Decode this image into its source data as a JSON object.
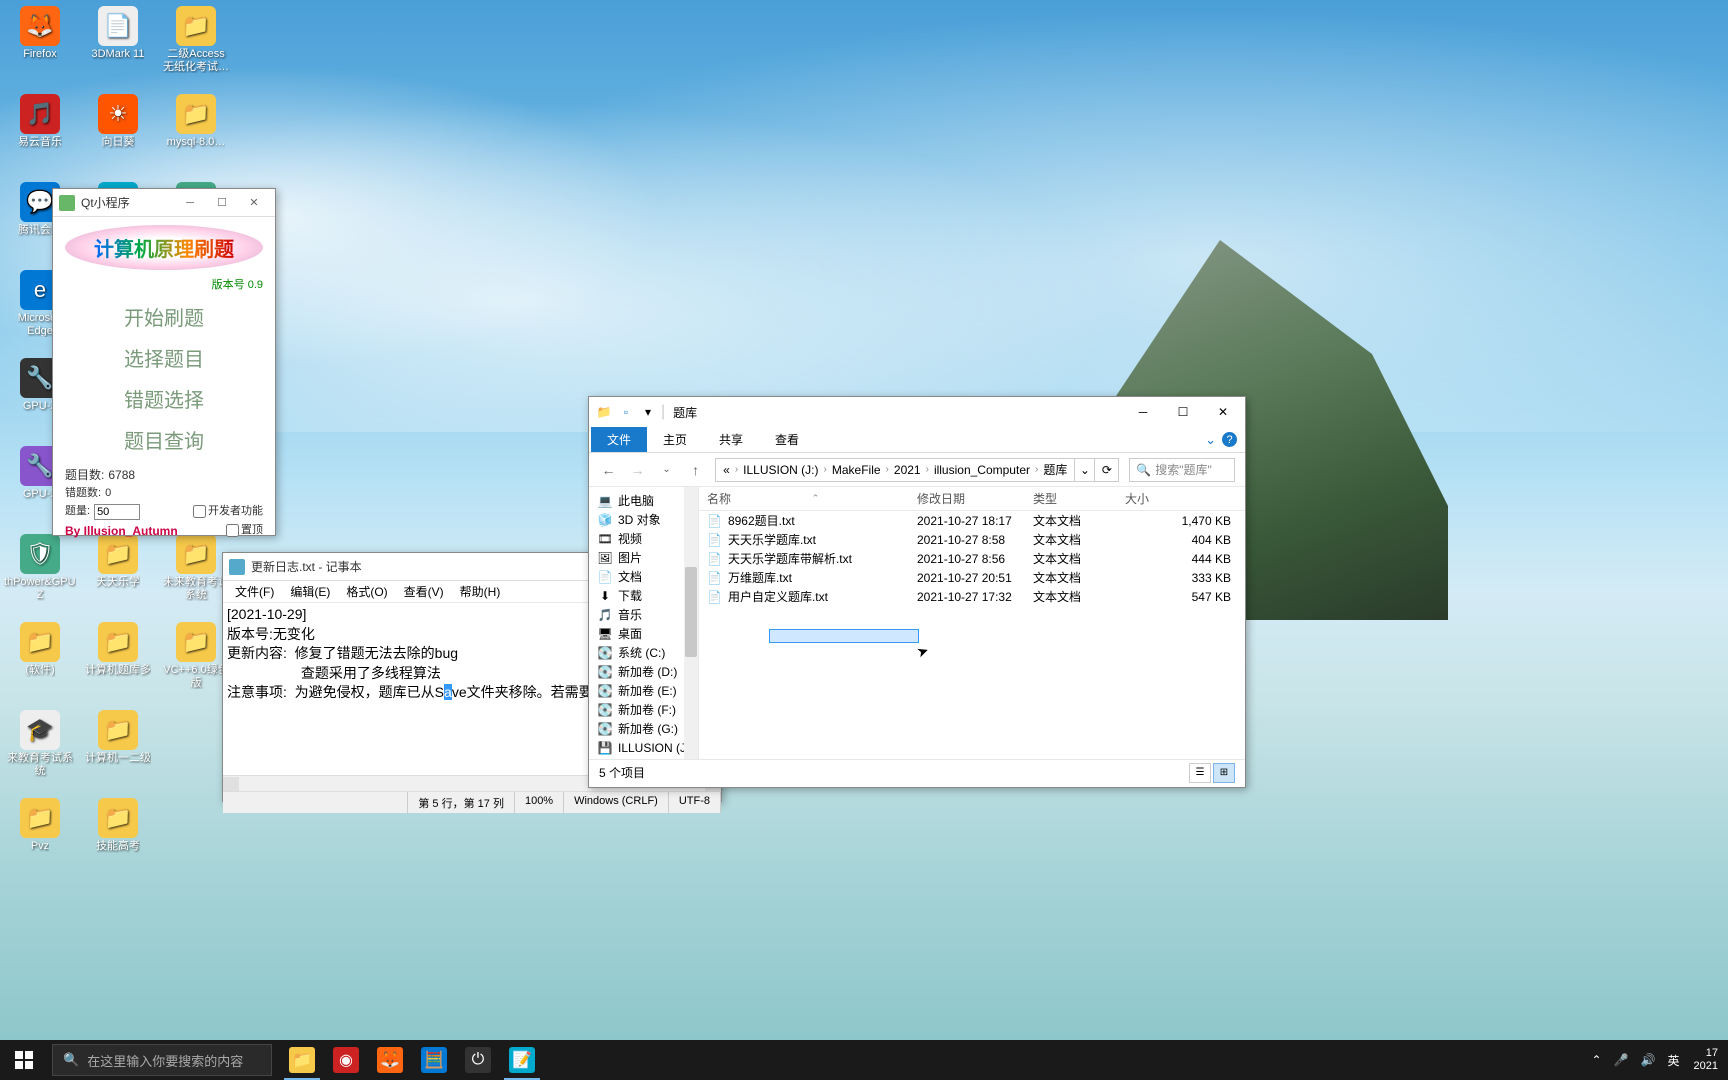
{
  "desktop_icons": [
    [
      {
        "label": "Firefox",
        "color": "c-ff",
        "glyph": "🦊"
      },
      {
        "label": "3DMark 11",
        "color": "c-wt",
        "glyph": "📄"
      },
      {
        "label": "二级Access无纸化考试…",
        "color": "c-yl",
        "glyph": "📁"
      }
    ],
    [
      {
        "label": "易云音乐",
        "color": "c-rd",
        "glyph": "🎵"
      },
      {
        "label": "向日葵",
        "color": "c-or",
        "glyph": "☀"
      },
      {
        "label": "mysql-8.0…",
        "color": "c-yl",
        "glyph": "📁"
      }
    ],
    [
      {
        "label": "腾讯会议",
        "color": "c-bl",
        "glyph": "💬"
      },
      {
        "label": "",
        "color": "c-cy",
        "glyph": "▶"
      },
      {
        "label": "",
        "color": "c-gr",
        "glyph": "🌀"
      }
    ],
    [
      {
        "label": "Microsoft Edge",
        "color": "c-bl",
        "glyph": "e"
      },
      {
        "label": "",
        "color": "",
        "glyph": ""
      },
      {
        "label": "",
        "color": "",
        "glyph": ""
      }
    ],
    [
      {
        "label": "GPU-Z",
        "color": "c-dk",
        "glyph": "🔧"
      },
      {
        "label": "",
        "color": "",
        "glyph": ""
      },
      {
        "label": "",
        "color": "",
        "glyph": ""
      }
    ],
    [
      {
        "label": "GPU-Z",
        "color": "c-pu",
        "glyph": "🔧"
      },
      {
        "label": "",
        "color": "",
        "glyph": ""
      },
      {
        "label": "",
        "color": "",
        "glyph": ""
      }
    ],
    [
      {
        "label": "thPower&GPU-Z",
        "color": "c-gr",
        "glyph": "🛡"
      },
      {
        "label": "天天乐学",
        "color": "c-yl",
        "glyph": "📁"
      },
      {
        "label": "未来教育考试系统",
        "color": "c-yl",
        "glyph": "📁"
      }
    ],
    [
      {
        "label": "(软件)",
        "color": "c-yl",
        "glyph": "📁"
      },
      {
        "label": "计算机题库多",
        "color": "c-yl",
        "glyph": "📁"
      },
      {
        "label": "VC++6.0绿色版",
        "color": "c-yl",
        "glyph": "📁"
      }
    ],
    [
      {
        "label": "来教育考试系统",
        "color": "c-wt",
        "glyph": "🎓"
      },
      {
        "label": "计算机一二级",
        "color": "c-yl",
        "glyph": "📁"
      },
      {
        "label": "",
        "color": "",
        "glyph": ""
      }
    ],
    [
      {
        "label": "Pvz",
        "color": "c-yl",
        "glyph": "📁"
      },
      {
        "label": "技能高考",
        "color": "c-yl",
        "glyph": "📁"
      },
      {
        "label": "",
        "color": "",
        "glyph": ""
      }
    ]
  ],
  "qt": {
    "title": "Qt小程序",
    "heading": "计算机原理刷题",
    "version": "版本号 0.9",
    "menu": [
      "开始刷题",
      "选择题目",
      "错题选择",
      "题目查询"
    ],
    "stats": {
      "total_label": "题目数:",
      "total_value": "6788",
      "wrong_label": "错题数:",
      "wrong_value": "0",
      "count_label": "题量:",
      "count_value": "50"
    },
    "dev_mode": "开发者功能",
    "pin": "置顶",
    "author": "By Illusion_Autumn"
  },
  "notepad": {
    "title": "更新日志.txt - 记事本",
    "menu": [
      "文件(F)",
      "编辑(E)",
      "格式(O)",
      "查看(V)",
      "帮助(H)"
    ],
    "lines": [
      "[2021-10-29]",
      "版本号:无变化",
      "更新内容:  修复了错题无法去除的bug",
      "                   查题采用了多线程算法",
      "注意事项:  为避免侵权，题库已从S"
    ],
    "sel_char": "a",
    "after_sel": "ve文件夹移除。若需要联系",
    "status": {
      "pos": "第 5 行，第 17 列",
      "zoom": "100%",
      "eol": "Windows (CRLF)",
      "enc": "UTF-8"
    }
  },
  "explorer": {
    "title": "题库",
    "tabs": {
      "file": "文件",
      "home": "主页",
      "share": "共享",
      "view": "查看"
    },
    "breadcrumb": [
      "« ",
      "ILLUSION (J:)",
      "MakeFile",
      "2021",
      "illusion_Computer",
      "题库"
    ],
    "search_placeholder": "搜索\"题库\"",
    "columns": {
      "name": "名称",
      "date": "修改日期",
      "type": "类型",
      "size": "大小"
    },
    "tree": [
      {
        "label": "此电脑",
        "glyph": "💻"
      },
      {
        "label": "3D 对象",
        "glyph": "🧊"
      },
      {
        "label": "视频",
        "glyph": "🎞"
      },
      {
        "label": "图片",
        "glyph": "🖼"
      },
      {
        "label": "文档",
        "glyph": "📄"
      },
      {
        "label": "下载",
        "glyph": "⬇"
      },
      {
        "label": "音乐",
        "glyph": "🎵"
      },
      {
        "label": "桌面",
        "glyph": "🖥"
      },
      {
        "label": "系统 (C:)",
        "glyph": "💽"
      },
      {
        "label": "新加卷 (D:)",
        "glyph": "💽"
      },
      {
        "label": "新加卷 (E:)",
        "glyph": "💽"
      },
      {
        "label": "新加卷 (F:)",
        "glyph": "💽"
      },
      {
        "label": "新加卷 (G:)",
        "glyph": "💽"
      },
      {
        "label": "ILLUSION (J:)",
        "glyph": "💾"
      }
    ],
    "files": [
      {
        "name": "8962题目.txt",
        "date": "2021-10-27 18:17",
        "type": "文本文档",
        "size": "1,470 KB"
      },
      {
        "name": "天天乐学题库.txt",
        "date": "2021-10-27 8:58",
        "type": "文本文档",
        "size": "404 KB"
      },
      {
        "name": "天天乐学题库带解析.txt",
        "date": "2021-10-27 8:56",
        "type": "文本文档",
        "size": "444 KB"
      },
      {
        "name": "万维题库.txt",
        "date": "2021-10-27 20:51",
        "type": "文本文档",
        "size": "333 KB"
      },
      {
        "name": "用户自定义题库.txt",
        "date": "2021-10-27 17:32",
        "type": "文本文档",
        "size": "547 KB"
      }
    ],
    "status": "5 个项目"
  },
  "taskbar": {
    "search_placeholder": "在这里输入你要搜索的内容",
    "items": [
      {
        "color": "c-yl",
        "glyph": "📁",
        "active": true
      },
      {
        "color": "c-rd",
        "glyph": "◉",
        "active": false
      },
      {
        "color": "c-ff",
        "glyph": "🦊",
        "active": false
      },
      {
        "color": "c-bl",
        "glyph": "🧮",
        "active": false
      },
      {
        "color": "c-dk",
        "glyph": "⏻",
        "active": false
      },
      {
        "color": "c-cy",
        "glyph": "📝",
        "active": true
      }
    ],
    "tray": {
      "ime": "英",
      "time": "17",
      "date": "2021"
    }
  }
}
